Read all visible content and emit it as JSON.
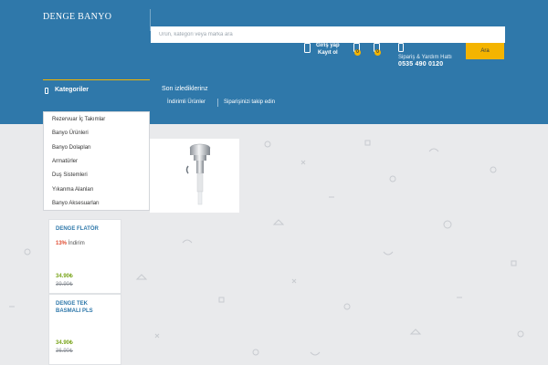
{
  "header": {
    "logo": "DENGE BANYO",
    "search_placeholder": "Ürün, kategori veya marka ara",
    "login_line1": "Giriş yap",
    "login_line2": "Kayıt ol",
    "fav_count": "0",
    "cart_count": "0",
    "support_label": "Sipariş & Yardım Hattı",
    "support_phone": "0535 490 0120",
    "search_button": "Ara",
    "colors": {
      "header": "#2f78aa",
      "accent": "#f4b400"
    }
  },
  "nav": {
    "categories_label": "Kategoriler",
    "recent_label": "Son izlediklerinz",
    "discounted_link": "İndirimli Ürünler",
    "track_link": "Siparişinizi takip edin"
  },
  "categories": [
    "Rezervuar İç Takımlar",
    "Banyo Ürünleri",
    "Banyo Dolapları",
    "Armatürler",
    "Duş Sistemleri",
    "Yıkanma Alanları",
    "Banyo Aksesuarları"
  ],
  "products": [
    {
      "name": "DENGE FLATÖR",
      "discount": "13%",
      "discount_label": "İndirim",
      "price": "34.90₺",
      "old_price": "39.90₺"
    },
    {
      "name": "DENGE TEK BASMALI PLS",
      "price": "34.90₺",
      "old_price": "36.90₺"
    }
  ]
}
